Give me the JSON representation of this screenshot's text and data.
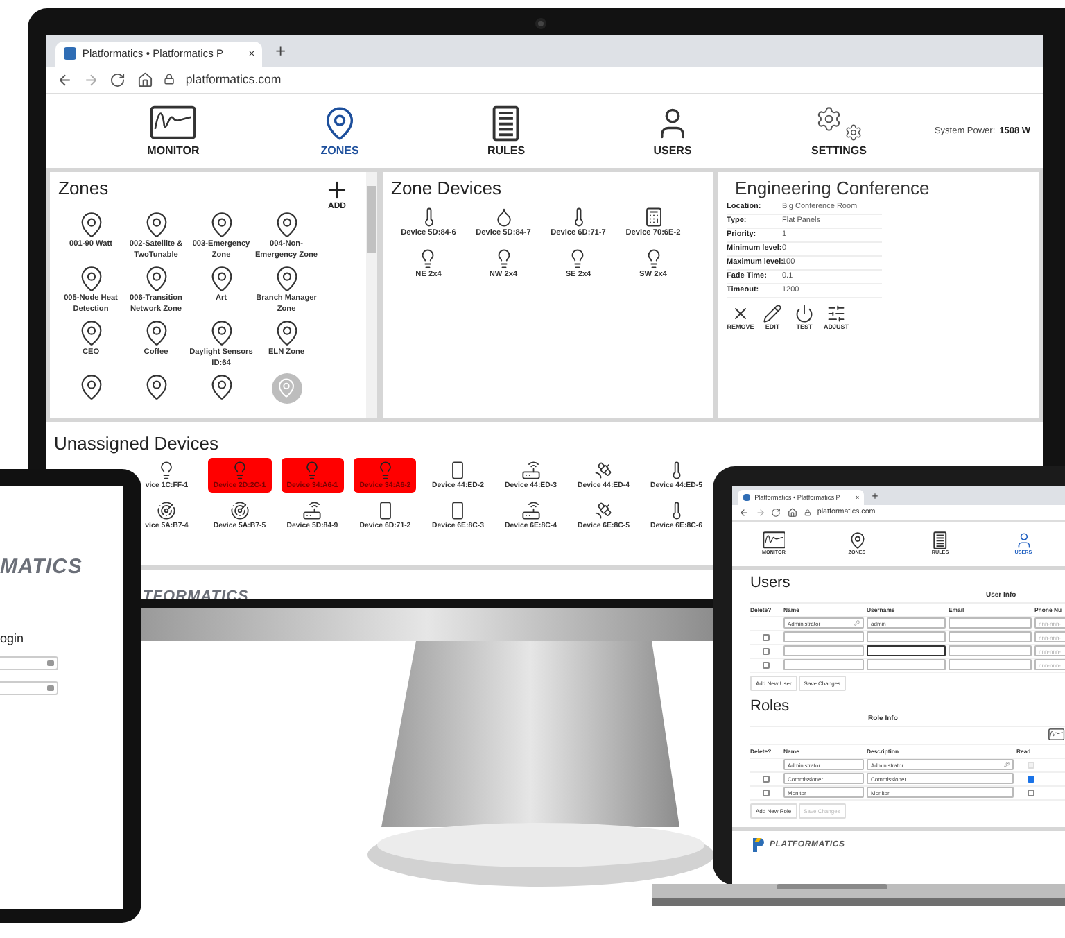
{
  "monitor": {
    "browser": {
      "tab_title": "Platformatics • Platformatics P",
      "tab_close": "×",
      "new_tab": "+",
      "url": "platformatics.com"
    },
    "nav": [
      {
        "label": "MONITOR",
        "kind": "monitor",
        "selected": false
      },
      {
        "label": "ZONES",
        "kind": "zones",
        "selected": true
      },
      {
        "label": "RULES",
        "kind": "rules",
        "selected": false
      },
      {
        "label": "USERS",
        "kind": "users",
        "selected": false
      },
      {
        "label": "SETTINGS",
        "kind": "settings",
        "selected": false
      }
    ],
    "system_power": {
      "label": "System Power:",
      "value": "1508 W"
    },
    "zones": {
      "title": "Zones",
      "add": "ADD",
      "items": [
        {
          "label": "001-90 Watt",
          "selected": false
        },
        {
          "label": "002-Satellite & TwoTunable",
          "selected": false
        },
        {
          "label": "003-Emergency Zone",
          "selected": false
        },
        {
          "label": "004-Non-Emergency Zone",
          "selected": false
        },
        {
          "label": "005-Node Heat Detection",
          "selected": false
        },
        {
          "label": "006-Transition Network Zone",
          "selected": false
        },
        {
          "label": "Art",
          "selected": false
        },
        {
          "label": "Branch Manager Zone",
          "selected": false
        },
        {
          "label": "CEO",
          "selected": false
        },
        {
          "label": "Coffee",
          "selected": false
        },
        {
          "label": "Daylight Sensors ID:64",
          "selected": false
        },
        {
          "label": "ELN Zone",
          "selected": false
        },
        {
          "selected": false
        },
        {
          "selected": false
        },
        {
          "selected": false
        },
        {
          "selected": true
        }
      ]
    },
    "zone_devices": {
      "title": "Zone Devices",
      "items": [
        {
          "label": "Device 5D:84-6",
          "kind": "thermometer"
        },
        {
          "label": "Device 5D:84-7",
          "kind": "droplet"
        },
        {
          "label": "Device 6D:71-7",
          "kind": "thermometer"
        },
        {
          "label": "Device 70:6E-2",
          "kind": "keypad"
        },
        {
          "label": "NE 2x4",
          "kind": "bulb"
        },
        {
          "label": "NW 2x4",
          "kind": "bulb"
        },
        {
          "label": "SE 2x4",
          "kind": "bulb"
        },
        {
          "label": "SW 2x4",
          "kind": "bulb"
        }
      ]
    },
    "zone_detail": {
      "title": "Engineering Conference",
      "fields": [
        {
          "label": "Location:",
          "value": "Big Conference Room"
        },
        {
          "label": "Type:",
          "value": "Flat Panels"
        },
        {
          "label": "Priority:",
          "value": "1"
        },
        {
          "label": "Minimum level:",
          "value": "0"
        },
        {
          "label": "Maximum level:",
          "value": "100"
        },
        {
          "label": "Fade Time:",
          "value": "0.1"
        },
        {
          "label": "Timeout:",
          "value": "1200"
        }
      ],
      "actions": [
        {
          "label": "REMOVE",
          "kind": "remove"
        },
        {
          "label": "EDIT",
          "kind": "edit"
        },
        {
          "label": "TEST",
          "kind": "test"
        },
        {
          "label": "ADJUST",
          "kind": "adjust"
        }
      ]
    },
    "unassigned": {
      "title": "Unassigned Devices",
      "items": [
        {
          "label": "vice 1C:FF-1",
          "kind": "bulb",
          "alert": false
        },
        {
          "label": "Device 2D:2C-1",
          "kind": "bulb",
          "alert": true
        },
        {
          "label": "Device 34:A6-1",
          "kind": "bulb",
          "alert": true
        },
        {
          "label": "Device 34:A6-2",
          "kind": "bulb",
          "alert": true
        },
        {
          "label": "Device 44:ED-2",
          "kind": "panel",
          "alert": false
        },
        {
          "label": "Device 44:ED-3",
          "kind": "hub",
          "alert": false
        },
        {
          "label": "Device 44:ED-4",
          "kind": "sensor",
          "alert": false
        },
        {
          "label": "Device 44:ED-5",
          "kind": "thermometer",
          "alert": false
        },
        {
          "label": "vice 5A:B7-4",
          "kind": "motion",
          "alert": false
        },
        {
          "label": "Device 5A:B7-5",
          "kind": "motion",
          "alert": false
        },
        {
          "label": "Device 5D:84-9",
          "kind": "hub",
          "alert": false
        },
        {
          "label": "Device 6D:71-2",
          "kind": "panel",
          "alert": false
        },
        {
          "label": "Device 6E:8C-3",
          "kind": "panel",
          "alert": false
        },
        {
          "label": "Device 6E:8C-4",
          "kind": "hub",
          "alert": false
        },
        {
          "label": "Device 6E:8C-5",
          "kind": "sensor",
          "alert": false
        },
        {
          "label": "Device 6E:8C-6",
          "kind": "thermometer",
          "alert": false
        }
      ]
    },
    "footer_logo": "TFORMATICS"
  },
  "tablet": {
    "logo": "MATICS",
    "heading": "ogin",
    "fields": [
      {
        "kind": "input"
      },
      {
        "kind": "input"
      }
    ]
  },
  "laptop": {
    "browser": {
      "tab_title": "Platformatics • Platformatics P",
      "tab_close": "×",
      "new_tab": "+",
      "url": "platformatics.com"
    },
    "nav": [
      {
        "label": "MONITOR",
        "kind": "monitor",
        "selected": false
      },
      {
        "label": "ZONES",
        "kind": "zones",
        "selected": false
      },
      {
        "label": "RULES",
        "kind": "rules",
        "selected": false
      },
      {
        "label": "USERS",
        "kind": "users",
        "selected": true
      }
    ],
    "users": {
      "title": "Users",
      "group": "User Info",
      "columns": [
        "Delete?",
        "Name",
        "Username",
        "Email",
        "Phone Nu"
      ],
      "rows": [
        {
          "name": "Administrator",
          "username": "admin",
          "phone_placeholder": "nnn-nnn-",
          "autofill": true,
          "focused": false
        },
        {
          "delete_checked": false,
          "phone_placeholder": "nnn-nnn-",
          "autofill": false,
          "focused": false
        },
        {
          "delete_checked": false,
          "phone_placeholder": "nnn-nnn-",
          "autofill": false,
          "focused": true
        },
        {
          "delete_checked": false,
          "phone_placeholder": "nnn-nnn-",
          "autofill": false,
          "focused": false
        }
      ],
      "buttons": [
        {
          "label": "Add New User",
          "disabled": false
        },
        {
          "label": "Save Changes",
          "disabled": false
        }
      ]
    },
    "roles": {
      "title": "Roles",
      "group": "Role Info",
      "columns": [
        "Delete?",
        "Name",
        "Description",
        "Read"
      ],
      "rows": [
        {
          "name": "Administrator",
          "description": "Administrator",
          "autofill": true,
          "read": false,
          "read_disabled": true
        },
        {
          "delete_checked": false,
          "name": "Commissioner",
          "description": "Commissioner",
          "autofill": false,
          "read": true,
          "read_disabled": false
        },
        {
          "delete_checked": false,
          "name": "Monitor",
          "description": "Monitor",
          "autofill": false,
          "read": false,
          "read_disabled": false
        }
      ],
      "buttons": [
        {
          "label": "Add New Role",
          "disabled": false
        },
        {
          "label": "Save Changes",
          "disabled": true
        }
      ]
    },
    "footer_logo": "PLATFORMATICS"
  }
}
